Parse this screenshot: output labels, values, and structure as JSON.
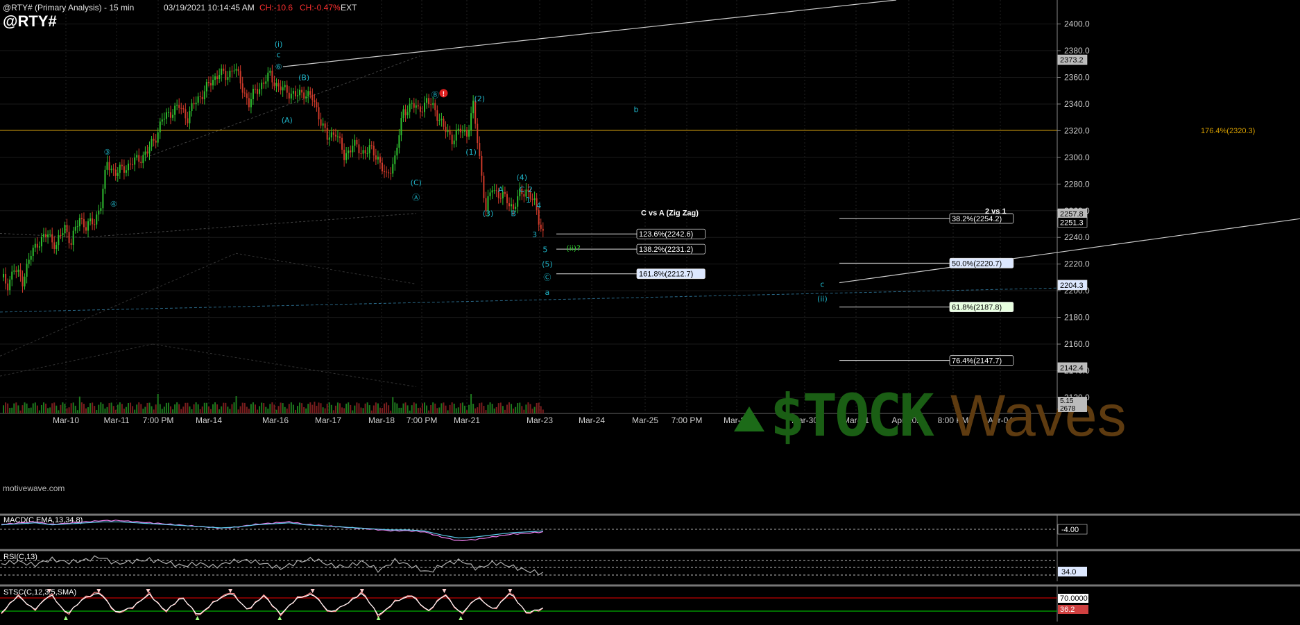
{
  "header": {
    "instrument_line": "@RTY# (Primary Analysis) - 15 min",
    "timestamp": "03/19/2021 10:14:45 AM",
    "change_points": "CH:-10.6",
    "change_percent": "CH:-0.47%",
    "session": "EXT",
    "symbol": "@RTY#",
    "watermark_small": "motivewave.com",
    "logo_text": "$TOCK",
    "logo_text2": "Waves"
  },
  "colors": {
    "background": "#000000",
    "up_candle": "#2fbf2f",
    "down_candle": "#d03a2a",
    "wave_label": "#1fb5c9",
    "fib_line": "#e0e0e0",
    "orange_line": "#d8a000",
    "macd": "#f080f0",
    "signal": "#5ac8e8",
    "rsi": "#b0b0b0",
    "stoch": "#ff8888",
    "stoch_mark": "#a0ff80",
    "overbought": "#c00000",
    "oversold": "#00b000"
  },
  "chart_data": [
    {
      "type": "candlestick",
      "title": "@RTY# (Primary Analysis) - 15 min",
      "x_ticks": [
        "Mar-10",
        "Mar-11",
        "7:00 PM",
        "Mar-14",
        "Mar-16",
        "Mar-17",
        "Mar-18",
        "7:00 PM",
        "Mar-21",
        "Mar-23",
        "Mar-24",
        "Mar-25",
        "7:00 PM",
        "Mar-28",
        "Mar-30",
        "Mar-31",
        "Apr-2021",
        "8:00 PM",
        "Apr-04"
      ],
      "y_ticks": [
        2120,
        2140,
        2160,
        2180,
        2200,
        2220,
        2240,
        2260,
        2280,
        2300,
        2320,
        2340,
        2360,
        2380,
        2400
      ],
      "ylim": [
        2108,
        2418
      ],
      "grid": true,
      "price_path": [
        [
          0,
          2210
        ],
        [
          3,
          2205
        ],
        [
          6,
          2216
        ],
        [
          10,
          2208
        ],
        [
          14,
          2227
        ],
        [
          17,
          2236
        ],
        [
          22,
          2242
        ],
        [
          26,
          2234
        ],
        [
          30,
          2248
        ],
        [
          33,
          2236
        ],
        [
          37,
          2255
        ],
        [
          40,
          2248
        ],
        [
          44,
          2252
        ],
        [
          47,
          2265
        ],
        [
          50,
          2296
        ],
        [
          54,
          2288
        ],
        [
          58,
          2292
        ],
        [
          62,
          2296
        ],
        [
          66,
          2300
        ],
        [
          69,
          2304
        ],
        [
          73,
          2316
        ],
        [
          76,
          2328
        ],
        [
          80,
          2334
        ],
        [
          84,
          2338
        ],
        [
          88,
          2330
        ],
        [
          91,
          2340
        ],
        [
          95,
          2348
        ],
        [
          99,
          2356
        ],
        [
          103,
          2364
        ],
        [
          106,
          2360
        ],
        [
          110,
          2368
        ],
        [
          114,
          2352
        ],
        [
          117,
          2340
        ],
        [
          120,
          2350
        ],
        [
          124,
          2356
        ],
        [
          127,
          2362
        ],
        [
          131,
          2352
        ],
        [
          135,
          2350
        ],
        [
          139,
          2346
        ],
        [
          143,
          2349
        ],
        [
          147,
          2344
        ],
        [
          150,
          2332
        ],
        [
          154,
          2314
        ],
        [
          158,
          2320
        ],
        [
          162,
          2300
        ],
        [
          166,
          2310
        ],
        [
          170,
          2304
        ],
        [
          174,
          2306
        ],
        [
          178,
          2300
        ],
        [
          182,
          2284
        ],
        [
          186,
          2300
        ],
        [
          190,
          2334
        ],
        [
          194,
          2340
        ],
        [
          197,
          2335
        ],
        [
          201,
          2342
        ],
        [
          205,
          2336
        ],
        [
          209,
          2322
        ],
        [
          213,
          2314
        ],
        [
          217,
          2320
        ],
        [
          220,
          2318
        ],
        [
          223,
          2338
        ],
        [
          226,
          2300
        ],
        [
          229,
          2260
        ],
        [
          232,
          2278
        ],
        [
          235,
          2272
        ],
        [
          239,
          2268
        ],
        [
          242,
          2262
        ],
        [
          245,
          2272
        ],
        [
          248,
          2276
        ],
        [
          252,
          2265
        ],
        [
          256,
          2243
        ]
      ],
      "fib_left_label": "C vs A (Zig Zag)",
      "fib_left": [
        {
          "label": "123.6%(2242.6)",
          "value": 2242.6
        },
        {
          "label": "138.2%(2231.2)",
          "value": 2231.2
        },
        {
          "label": "161.8%(2212.7)",
          "value": 2212.7
        }
      ],
      "fib_right_label": "2 vs 1",
      "fib_right": [
        {
          "label": "38.2%(2254.2)",
          "value": 2254.2
        },
        {
          "label": "50.0%(2220.7)",
          "value": 2220.7
        },
        {
          "label": "61.8%(2187.8)",
          "value": 2187.8
        },
        {
          "label": "76.4%(2147.7)",
          "value": 2147.7
        }
      ],
      "horizontal_level": {
        "label": "176.4%(2320.3)",
        "value": 2320.3
      },
      "axis_tags": [
        {
          "label": "2373.2",
          "value": 2373.2
        },
        {
          "label": "2257.8",
          "value": 2257.8
        },
        {
          "label": "2251.3",
          "value": 2251.3
        },
        {
          "label": "2204.3",
          "value": 2204.3
        },
        {
          "label": "2142.4",
          "value": 2142.4
        }
      ],
      "volume_tags": [
        "5.15",
        "2678"
      ],
      "wave_labels": [
        {
          "text": "(i)",
          "bar": 131,
          "value": 2383
        },
        {
          "text": "c",
          "bar": 131,
          "value": 2375
        },
        {
          "text": "⑥",
          "bar": 131,
          "value": 2366
        },
        {
          "text": "(B)",
          "bar": 143,
          "value": 2358
        },
        {
          "text": "(A)",
          "bar": 135,
          "value": 2326
        },
        {
          "text": "③",
          "bar": 50,
          "value": 2302
        },
        {
          "text": "④",
          "bar": 53,
          "value": 2263
        },
        {
          "text": "(C)",
          "bar": 196,
          "value": 2279
        },
        {
          "text": "Ⓐ",
          "bar": 196,
          "value": 2268
        },
        {
          "text": "Ⓑ",
          "bar": 205,
          "value": 2345
        },
        {
          "text": "(2)",
          "bar": 226,
          "value": 2342
        },
        {
          "text": "(1)",
          "bar": 222,
          "value": 2302
        },
        {
          "text": "(3)",
          "bar": 230,
          "value": 2256
        },
        {
          "text": "(4)",
          "bar": 246,
          "value": 2283
        },
        {
          "text": "A",
          "bar": 236,
          "value": 2274
        },
        {
          "text": "B",
          "bar": 242,
          "value": 2256
        },
        {
          "text": "C",
          "bar": 246,
          "value": 2274
        },
        {
          "text": "2",
          "bar": 250,
          "value": 2274
        },
        {
          "text": "1",
          "bar": 249,
          "value": 2266
        },
        {
          "text": "4",
          "bar": 254,
          "value": 2262
        },
        {
          "text": "3",
          "bar": 252,
          "value": 2240
        },
        {
          "text": "5",
          "bar": 257,
          "value": 2229
        },
        {
          "text": "(5)",
          "bar": 258,
          "value": 2218
        },
        {
          "text": "Ⓒ",
          "bar": 258,
          "value": 2208
        },
        {
          "text": "a",
          "bar": 258,
          "value": 2197
        },
        {
          "text": "b",
          "bar": 300,
          "value": 2334
        },
        {
          "text": "c",
          "bar": 388,
          "value": 2203
        },
        {
          "text": "(ii)",
          "bar": 388,
          "value": 2192
        }
      ],
      "green_label": {
        "text": "(ii)?",
        "bar": 267,
        "value": 2230
      }
    },
    {
      "type": "line",
      "title": "MACD(C,EMA,13,34,8)",
      "series": [
        {
          "name": "MACD"
        },
        {
          "name": "Signal"
        }
      ],
      "axis_tag": "-4.00",
      "values": [
        2,
        3,
        4,
        2,
        3,
        4,
        5,
        5,
        4,
        3,
        2,
        1,
        0,
        -1,
        0,
        2,
        3,
        4,
        2,
        1,
        0,
        -1,
        -2,
        -3,
        -3,
        -4,
        -8,
        -11,
        -10,
        -8,
        -6,
        -5,
        -4
      ]
    },
    {
      "type": "line",
      "title": "RSI(C,13)",
      "series": [
        {
          "name": "RSI"
        }
      ],
      "levels": [
        "70",
        "50",
        "30"
      ],
      "axis_tag": "34.0",
      "values": [
        55,
        60,
        52,
        65,
        58,
        62,
        70,
        55,
        60,
        64,
        58,
        50,
        56,
        48,
        60,
        62,
        55,
        45,
        58,
        66,
        52,
        48,
        60,
        40,
        62,
        50,
        36,
        55,
        62,
        44,
        58,
        50,
        40,
        34
      ]
    },
    {
      "type": "line",
      "title": "STSC(C,12,3,5,SMA)",
      "series": [
        {
          "name": "%K"
        },
        {
          "name": "%D"
        }
      ],
      "levels": [
        "70.0000",
        "36.2"
      ],
      "axis_tag_upper": "70.0000",
      "axis_tag_lower": "36.2",
      "values": [
        20,
        80,
        30,
        85,
        15,
        70,
        90,
        20,
        40,
        85,
        25,
        75,
        10,
        60,
        90,
        30,
        80,
        15,
        70,
        85,
        20,
        50,
        90,
        10,
        60,
        80,
        25,
        85,
        15,
        75,
        30,
        90,
        20,
        36
      ]
    }
  ]
}
